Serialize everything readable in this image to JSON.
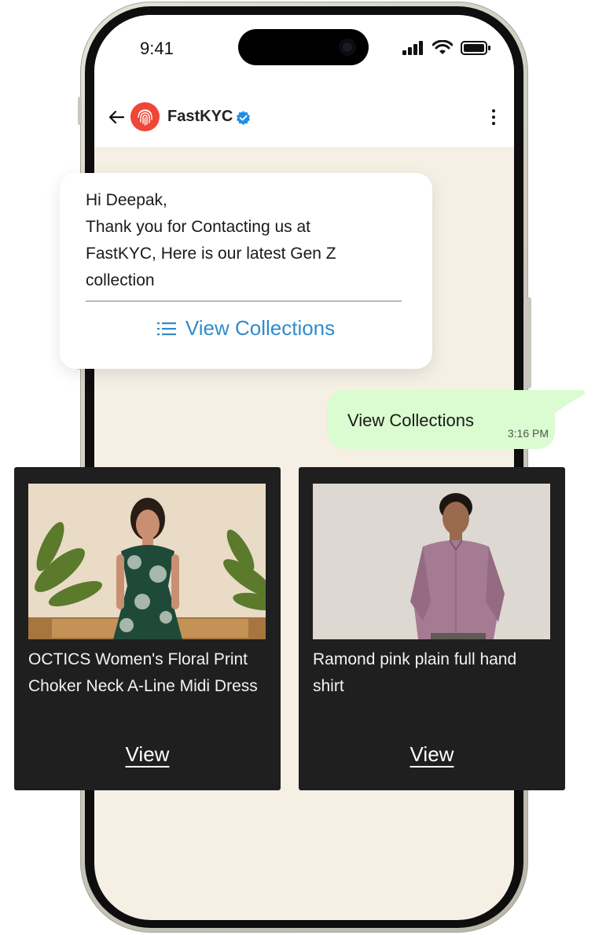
{
  "status_bar": {
    "time": "9:41"
  },
  "header": {
    "title": "FastKYC"
  },
  "messages": {
    "incoming": {
      "lines": [
        "Hi Deepak,",
        "Thank you for Contacting us at",
        "FastKYC,  Here is our latest Gen Z",
        "collection"
      ],
      "cta_label": "View Collections"
    },
    "outgoing": {
      "text": "View Collections",
      "time": "3:16 PM"
    }
  },
  "products": [
    {
      "title": "OCTICS Women's Floral Print Choker Neck A-Line Midi Dress",
      "button": "View"
    },
    {
      "title": "Ramond pink plain full hand shirt",
      "button": "View"
    }
  ],
  "colors": {
    "chat_background": "#f5efe4",
    "accent_link": "#2f8ccd",
    "outgoing_bubble": "#dafcd0",
    "card_background": "#1f1f1f",
    "avatar": "#ef4636",
    "verified": "#1d8ee8"
  },
  "icons": [
    "back-arrow-icon",
    "fingerprint-icon",
    "verified-badge-icon",
    "kebab-menu-icon",
    "list-icon",
    "signal-icon",
    "wifi-icon",
    "battery-icon"
  ]
}
